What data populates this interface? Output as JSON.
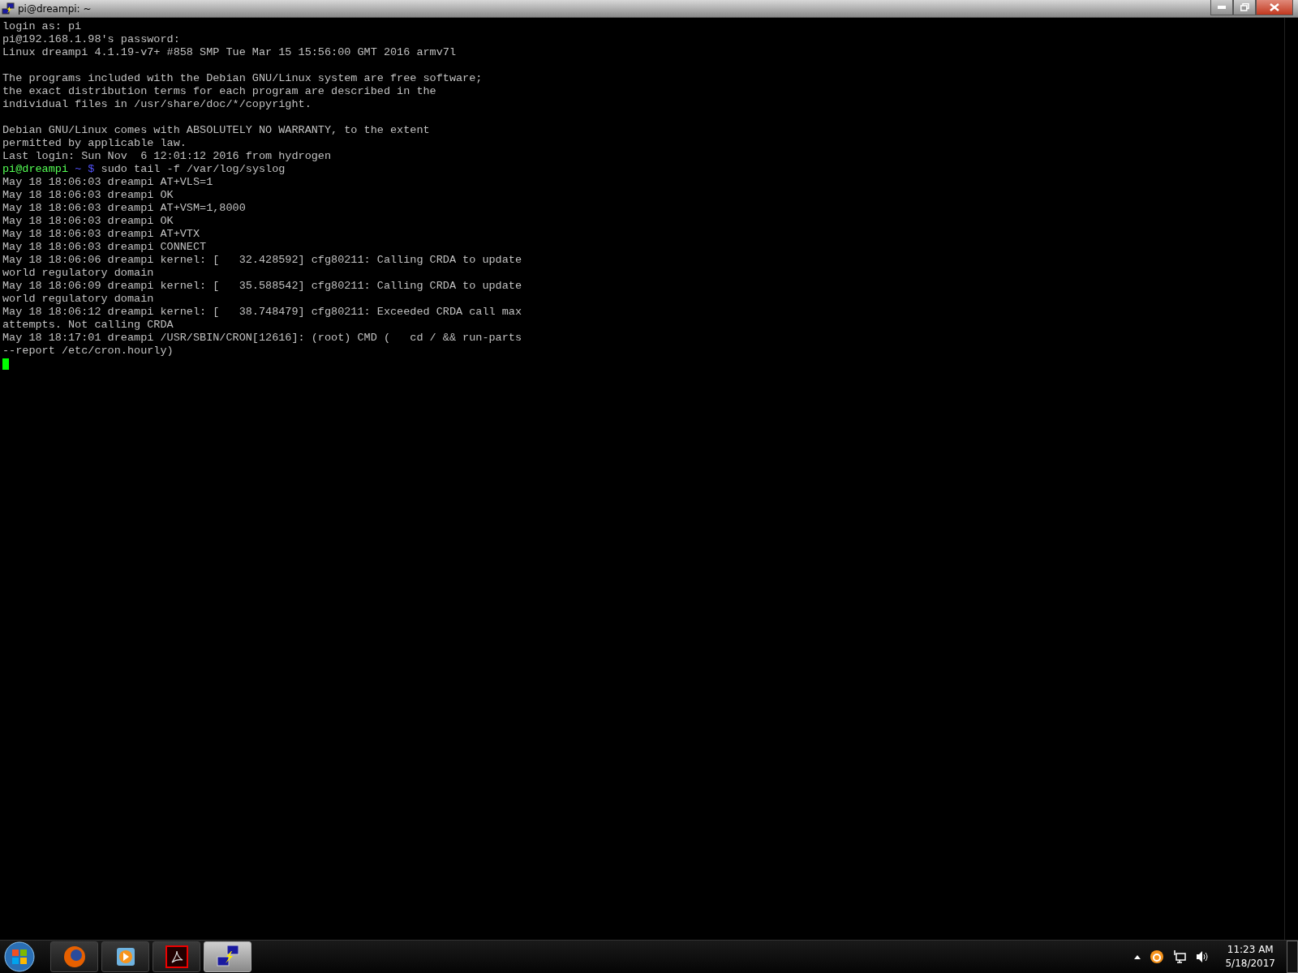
{
  "window": {
    "title": "pi@dreampi: ~"
  },
  "terminal": {
    "lines": [
      {
        "kind": "text",
        "text": "login as: pi"
      },
      {
        "kind": "text",
        "text": "pi@192.168.1.98's password:"
      },
      {
        "kind": "text",
        "text": "Linux dreampi 4.1.19-v7+ #858 SMP Tue Mar 15 15:56:00 GMT 2016 armv7l"
      },
      {
        "kind": "blank"
      },
      {
        "kind": "text",
        "text": "The programs included with the Debian GNU/Linux system are free software;"
      },
      {
        "kind": "text",
        "text": "the exact distribution terms for each program are described in the"
      },
      {
        "kind": "text",
        "text": "individual files in /usr/share/doc/*/copyright."
      },
      {
        "kind": "blank"
      },
      {
        "kind": "text",
        "text": "Debian GNU/Linux comes with ABSOLUTELY NO WARRANTY, to the extent"
      },
      {
        "kind": "text",
        "text": "permitted by applicable law."
      },
      {
        "kind": "text",
        "text": "Last login: Sun Nov  6 12:01:12 2016 from hydrogen"
      },
      {
        "kind": "prompt",
        "user_host": "pi@dreampi",
        "path": "~",
        "symbol": "$",
        "command": "sudo tail -f /var/log/syslog"
      },
      {
        "kind": "text",
        "text": "May 18 18:06:03 dreampi AT+VLS=1"
      },
      {
        "kind": "text",
        "text": "May 18 18:06:03 dreampi OK"
      },
      {
        "kind": "text",
        "text": "May 18 18:06:03 dreampi AT+VSM=1,8000"
      },
      {
        "kind": "text",
        "text": "May 18 18:06:03 dreampi OK"
      },
      {
        "kind": "text",
        "text": "May 18 18:06:03 dreampi AT+VTX"
      },
      {
        "kind": "text",
        "text": "May 18 18:06:03 dreampi CONNECT"
      },
      {
        "kind": "text",
        "text": "May 18 18:06:06 dreampi kernel: [   32.428592] cfg80211: Calling CRDA to update"
      },
      {
        "kind": "text",
        "text": "world regulatory domain"
      },
      {
        "kind": "text",
        "text": "May 18 18:06:09 dreampi kernel: [   35.588542] cfg80211: Calling CRDA to update"
      },
      {
        "kind": "text",
        "text": "world regulatory domain"
      },
      {
        "kind": "text",
        "text": "May 18 18:06:12 dreampi kernel: [   38.748479] cfg80211: Exceeded CRDA call max"
      },
      {
        "kind": "text",
        "text": "attempts. Not calling CRDA"
      },
      {
        "kind": "text",
        "text": "May 18 18:17:01 dreampi /USR/SBIN/CRON[12616]: (root) CMD (   cd / && run-parts"
      },
      {
        "kind": "text",
        "text": "--report /etc/cron.hourly)"
      },
      {
        "kind": "cursor"
      }
    ]
  },
  "taskbar": {
    "items": [
      {
        "kind": "firefox",
        "selected": false
      },
      {
        "kind": "media",
        "selected": false
      },
      {
        "kind": "pdf",
        "selected": false
      },
      {
        "kind": "putty",
        "selected": true
      }
    ],
    "clock": {
      "time": "11:23 AM",
      "date": "5/18/2017"
    }
  }
}
